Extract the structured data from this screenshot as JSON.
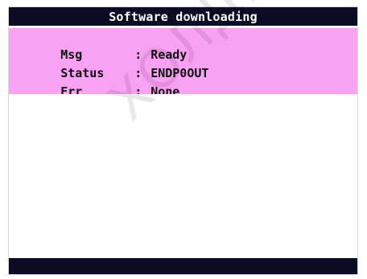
{
  "window": {
    "title": "Software downloading"
  },
  "info": {
    "rows": [
      {
        "key": "Msg",
        "sep": ":",
        "value": "Ready"
      },
      {
        "key": "Status",
        "sep": ":",
        "value": "ENDP0OUT"
      },
      {
        "key": "Err",
        "sep": ":",
        "value": "None"
      }
    ]
  },
  "watermark": {
    "text": "ХОЛДИНГ"
  },
  "colors": {
    "title_bar": "#0c0c24",
    "info_panel": "#f9a1f3",
    "status_bar": "#0c0c24"
  }
}
